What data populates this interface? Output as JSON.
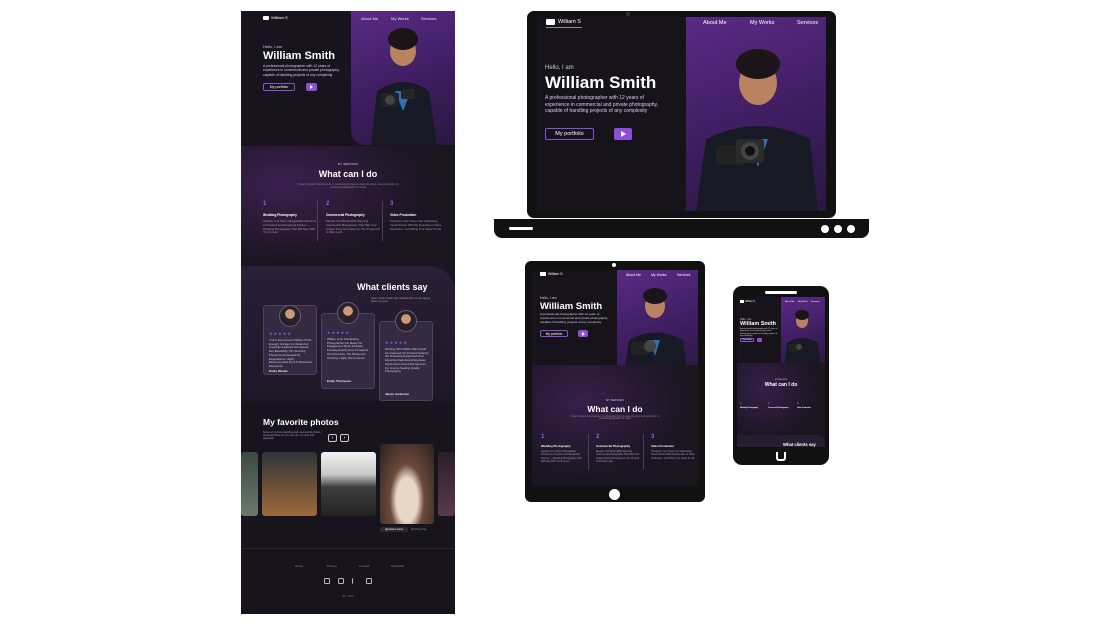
{
  "brand": {
    "logo_text": "William S"
  },
  "nav": {
    "about": "About Me",
    "works": "My Works",
    "services": "Services"
  },
  "hero": {
    "greeting": "Hello, I am",
    "name": "William Smith",
    "description": "A professional photographer with 12 years of experience in commercial and private photography, capable of handling projects of any complexity",
    "portfolio_button": "My portfolio"
  },
  "services": {
    "kicker": "MY SERVICES",
    "title": "What can I do",
    "subtitle": "I have 12 years of experience in professional photo & video shooting, post-production, & processing/adaptation of media",
    "items": [
      {
        "num": "1",
        "title": "Wedding Photography",
        "desc": "Capture Your Most Unforgettable Moments In Timeless And Emotional Frames — Wedding Photography That Will Stay With You Forever"
      },
      {
        "num": "2",
        "title": "Commercial Photography",
        "desc": "Elevate Your Brand With Stunning Commercial Photography That Tells Your Unique Story And Captures Your Product At Its Best Light"
      },
      {
        "num": "3",
        "title": "Video Production",
        "desc": "Transform Your Vision Into Captivating Visual Stories With My Expertise In Video Production. Let's Bring Your Ideas To Life"
      }
    ]
  },
  "clients": {
    "title": "What clients say",
    "subtitle": "Here's what people who worked with me are saying about my work",
    "stars": "★★★★★",
    "items": [
      {
        "text": "I Can't Recommend William Smith Enough. His Eye For Detail And Creativity Captured Our Special Day Beautifully. The Stunning Photos Far Exceeded My Expectations. Highly Recommended For A Professional Experience",
        "name": "Emily Woods"
      },
      {
        "text": "William Is An Outstanding Photographer! He Made Our Engagement Shoot Fantastic, Knowing Exactly How To Capture Our Chemistry. The Photos Are Amazing. Highly Recommend!",
        "name": "Emily Thompson"
      },
      {
        "text": "Working With William Was Great! He Captured Our Product Perfectly. His Professional Approach And Expertise Made Everything Easy. Highly Recommend His Services For Anyone Seeking Quality Photography",
        "name": "James Anderson"
      }
    ]
  },
  "photos": {
    "title": "My favorite photos",
    "subtitle": "Some of my best wedding and commercial photos, presented here so you can see my style and approach",
    "caption_1": "@ourtime turns",
    "caption_2": "Wedding Day"
  },
  "footer": {
    "links": [
      "Home",
      "Privacy",
      "Contact",
      "Subscribe"
    ],
    "copyright": "Est. 2024"
  },
  "colors": {
    "accent": "#8b4fd8",
    "background": "#18141d",
    "hero_purple": "#5a2a86"
  },
  "icons": [
    "camera-logo-icon",
    "play-icon",
    "star-icon",
    "arrow-left-icon",
    "arrow-right-icon",
    "instagram-icon",
    "linkedin-icon",
    "facebook-icon",
    "behance-icon"
  ]
}
